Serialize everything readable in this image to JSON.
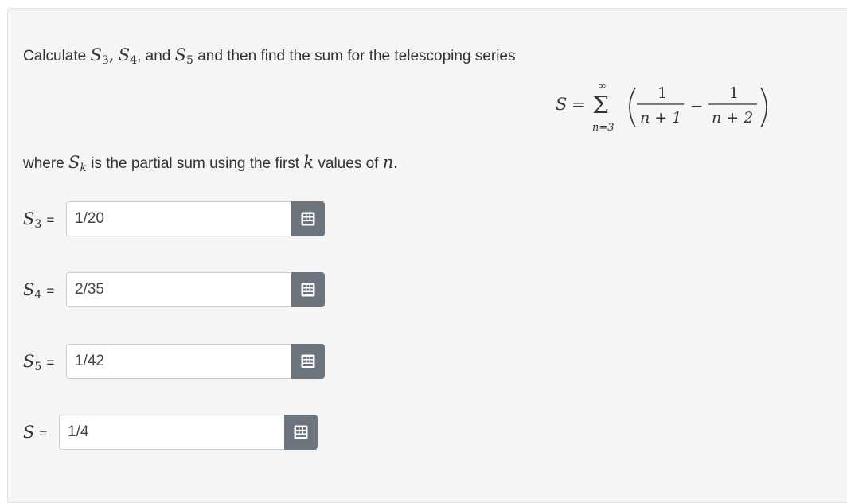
{
  "question": {
    "intro": "Calculate",
    "sep1": ",",
    "sep2": ", and",
    "mid": "and then find the sum for the telescoping series",
    "where_prefix": "where",
    "where_suffix": "is the partial sum using the first",
    "where_k": "k",
    "where_end": "values of",
    "where_n": "n",
    "period": "."
  },
  "formula": {
    "lhs": "S",
    "equals": "=",
    "sigma": "Σ",
    "upper": "∞",
    "lower": "n=3",
    "frac1_num": "1",
    "frac1_den": "n + 1",
    "minus": "−",
    "frac2_num": "1",
    "frac2_den": "n + 2"
  },
  "answers": [
    {
      "var": "S",
      "sub": "3",
      "equals": "=",
      "value": "1/20"
    },
    {
      "var": "S",
      "sub": "4",
      "equals": "=",
      "value": "2/35"
    },
    {
      "var": "S",
      "sub": "5",
      "equals": "=",
      "value": "1/42"
    },
    {
      "var": "S",
      "sub": "",
      "equals": "=",
      "value": "1/4"
    }
  ],
  "symbols": {
    "S": "S",
    "s3": "3",
    "s4": "4",
    "s5": "5",
    "k": "k"
  },
  "icons": {
    "keyboard": "keyboard-icon"
  },
  "colors": {
    "panel": "#f5f5f5",
    "button": "#6c757d",
    "text": "#333333"
  }
}
